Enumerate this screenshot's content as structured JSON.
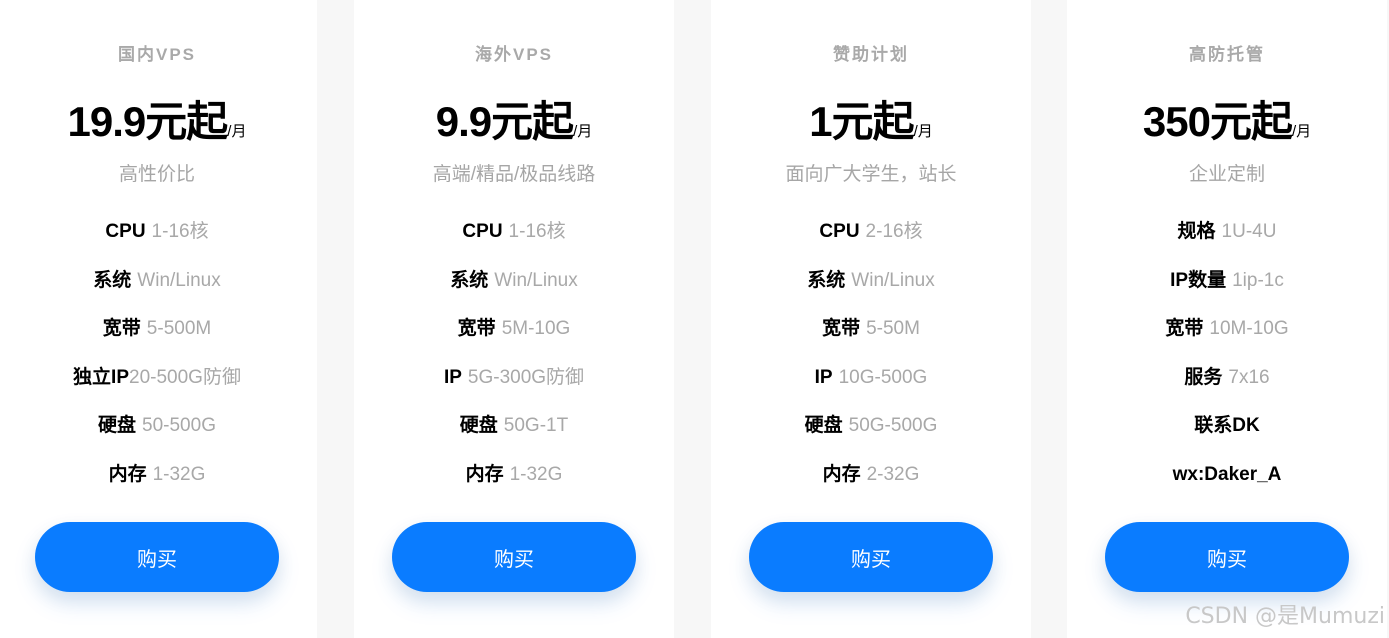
{
  "plans": [
    {
      "name": "国内VPS",
      "price": "19.9元起",
      "unit": "/月",
      "subtitle": "高性价比",
      "specs": [
        {
          "label": "CPU",
          "value": "1-16核"
        },
        {
          "label": "系统",
          "value": "Win/Linux"
        },
        {
          "label": "宽带",
          "value": "5-500M"
        },
        {
          "label": "独立IP",
          "value": "20-500G防御"
        },
        {
          "label": "硬盘",
          "value": "50-500G"
        },
        {
          "label": "内存",
          "value": "1-32G"
        }
      ],
      "button": "购买"
    },
    {
      "name": "海外VPS",
      "price": "9.9元起",
      "unit": "/月",
      "subtitle": "高端/精品/极品线路",
      "specs": [
        {
          "label": "CPU",
          "value": "1-16核"
        },
        {
          "label": "系统",
          "value": "Win/Linux"
        },
        {
          "label": "宽带",
          "value": "5M-10G"
        },
        {
          "label": "IP",
          "value": "5G-300G防御"
        },
        {
          "label": "硬盘",
          "value": "50G-1T"
        },
        {
          "label": "内存",
          "value": "1-32G"
        }
      ],
      "button": "购买"
    },
    {
      "name": "赞助计划",
      "price": "1元起",
      "unit": "/月",
      "subtitle": "面向广大学生，站长",
      "specs": [
        {
          "label": "CPU",
          "value": "2-16核"
        },
        {
          "label": "系统",
          "value": "Win/Linux"
        },
        {
          "label": "宽带",
          "value": "5-50M"
        },
        {
          "label": "IP",
          "value": "10G-500G"
        },
        {
          "label": "硬盘",
          "value": "50G-500G"
        },
        {
          "label": "内存",
          "value": "2-32G"
        }
      ],
      "button": "购买"
    },
    {
      "name": "高防托管",
      "price": "350元起",
      "unit": "/月",
      "subtitle": "企业定制",
      "specs": [
        {
          "label": "规格",
          "value": "1U-4U"
        },
        {
          "label": "IP数量",
          "value": "1ip-1c"
        },
        {
          "label": "宽带",
          "value": "10M-10G"
        },
        {
          "label": "服务",
          "value": "7x16"
        },
        {
          "label": "联系DK",
          "value": ""
        },
        {
          "label": "wx:Daker_A",
          "value": ""
        }
      ],
      "button": "购买"
    }
  ],
  "watermark": "CSDN @是Mumuzi",
  "colors": {
    "button": "#0a7cff",
    "muted_text": "#a8a8a8",
    "card_bg": "#ffffff",
    "page_bg": "#f7f7f7"
  }
}
